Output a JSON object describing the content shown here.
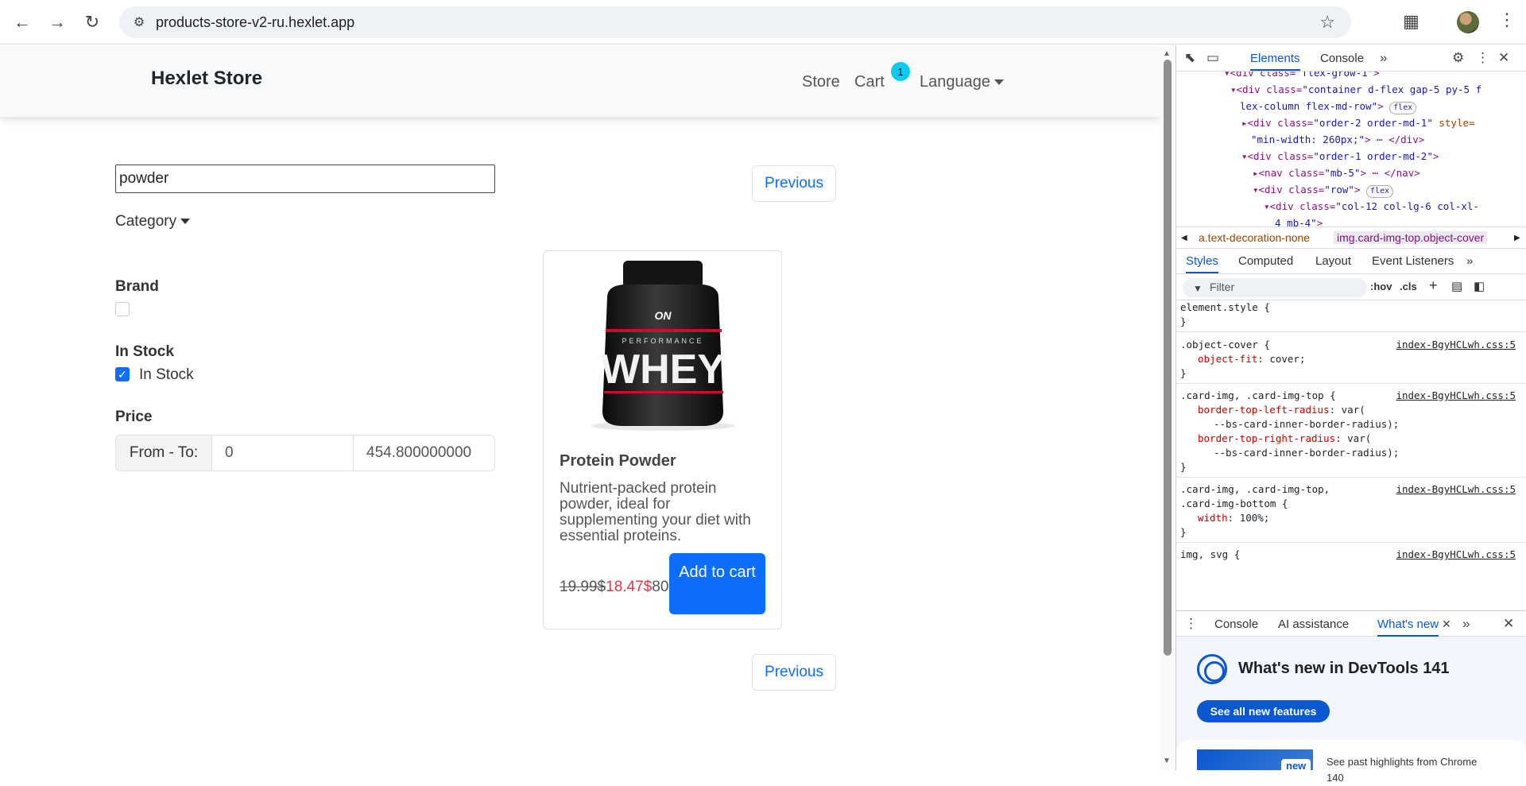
{
  "browser": {
    "url": "products-store-v2-ru.hexlet.app"
  },
  "site": {
    "brand": "Hexlet Store",
    "nav": {
      "store": "Store",
      "cart": "Cart",
      "cart_count": "1",
      "language": "Language"
    }
  },
  "filters": {
    "search_value": "powder",
    "category_label": "Category",
    "brand_label": "Brand",
    "in_stock_heading": "In Stock",
    "in_stock_option": "In Stock",
    "in_stock_checked": true,
    "price_label": "Price",
    "price_prefix": "From - To:",
    "price_from": "0",
    "price_to": "454.800000000"
  },
  "pagination": {
    "previous_label": "Previous"
  },
  "product": {
    "title": "Protein Powder",
    "description": "Nutrient-packed protein powder, ideal for supplementing your diet with essential proteins.",
    "old_price": "19.99$",
    "new_price": "18.47$",
    "qty_text": "80",
    "add_to_cart": "Add to cart",
    "image_brand": "ON",
    "image_line": "PERFORMANCE",
    "image_product": "WHEY"
  },
  "devtools": {
    "tabs": [
      "Elements",
      "Console"
    ],
    "active_tab": "Elements",
    "dom_lines": [
      {
        "open": "<div class=",
        "attr_val": "\"flex-grow-1\"",
        "close": ">"
      },
      {
        "open": "<div class=",
        "attr_val": "\"container d-flex gap-5 py-5 f",
        "close": ""
      },
      {
        "open": "",
        "attr_val": "lex-column flex-md-row\"",
        "close": ">"
      },
      {
        "open": "<div class=",
        "attr_val": "\"order-2 order-md-1\"",
        "close": " style="
      },
      {
        "open": "",
        "attr_val": "\"min-width: 260px;\"",
        "close": "> ⋯ </div>"
      },
      {
        "open": "<div class=",
        "attr_val": "\"order-1 order-md-2\"",
        "close": ">"
      },
      {
        "open": "<nav class=",
        "attr_val": "\"mb-5\"",
        "close": "> ⋯ </nav>"
      },
      {
        "open": "<div class=",
        "attr_val": "\"row\"",
        "close": ">"
      },
      {
        "open": "<div class=",
        "attr_val": "\"col-12 col-lg-6 col-xl-",
        "close": ""
      },
      {
        "open": "",
        "attr_val": "4 mb-4\"",
        "close": ">"
      }
    ],
    "pill_label": "flex",
    "breadcrumbs": [
      "a.text-decoration-none",
      "img.card-img-top.object-cover"
    ],
    "subtabs": [
      "Styles",
      "Computed",
      "Layout",
      "Event Listeners"
    ],
    "active_subtab": "Styles",
    "filter_placeholder": "Filter",
    "filter_tools": [
      ":hov",
      ".cls"
    ],
    "style_rules": [
      {
        "selector": "element.style {",
        "source": ""
      },
      {
        "selector": ".object-cover {",
        "source": "index-BgyHCLwh.css:5"
      },
      {
        "selector": ".card-img, .card-img-top {",
        "source": "index-BgyHCLwh.css:5"
      },
      {
        "selector": ".card-img, .card-img-top,",
        "source": "index-BgyHCLwh.css:5"
      },
      {
        "selector": "img, svg {",
        "source": "index-BgyHCLwh.css:5"
      }
    ],
    "style_props": [
      {
        "name": "object-fit",
        "value": "cover;"
      },
      {
        "name": "border-top-left-radius",
        "value": "var("
      },
      {
        "name": "",
        "value": "--bs-card-inner-border-radius);"
      },
      {
        "name": "border-top-right-radius",
        "value": "var("
      },
      {
        "name": "",
        "value": "--bs-card-inner-border-radius);"
      },
      {
        "name": "width",
        "value": "100%;"
      }
    ],
    "selector_cont": ".card-img-bottom {",
    "drawer_tabs": [
      "Console",
      "AI assistance",
      "What's new"
    ],
    "active_drawer_tab": "What's new",
    "whats_new_title": "What's new in DevTools 141",
    "see_all": "See all new features",
    "new_badge": "new",
    "highlights": "See past highlights from Chrome 140"
  },
  "colors": {
    "primary": "#0d6efd",
    "sale": "#dc3545",
    "badge": "#0dcaf0",
    "devtools_accent": "#0b57d0"
  }
}
